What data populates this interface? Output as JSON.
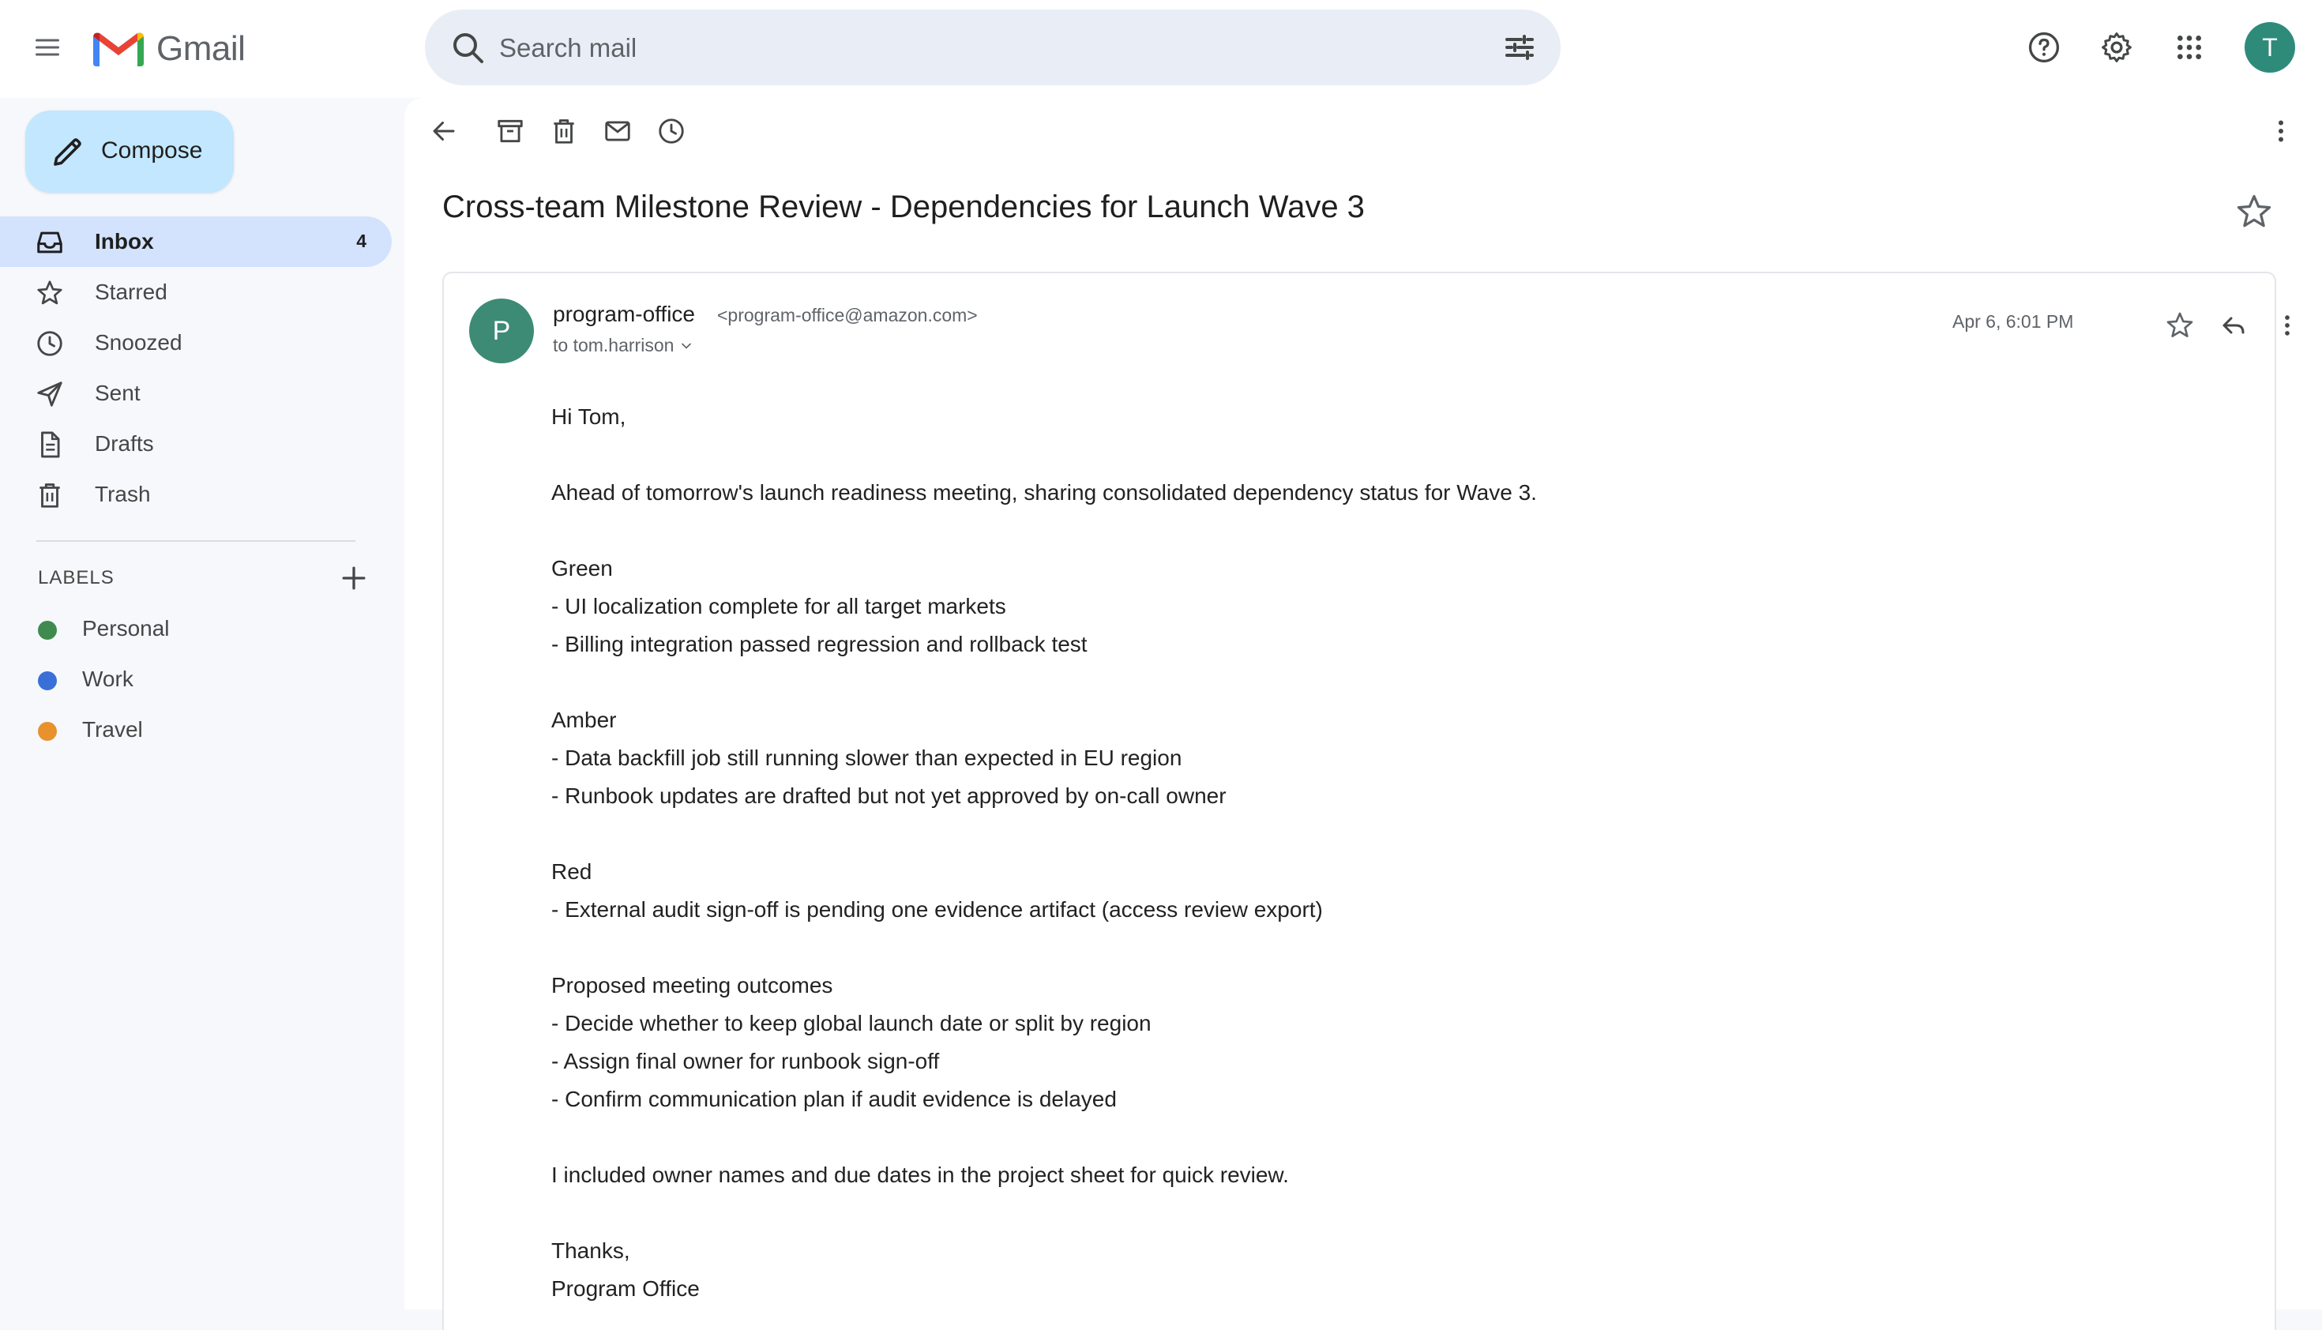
{
  "app": {
    "name": "Gmail"
  },
  "search": {
    "placeholder": "Search mail"
  },
  "header": {
    "user_initial": "T",
    "icons": [
      "help-icon",
      "settings-icon",
      "apps-icon"
    ]
  },
  "sidebar": {
    "compose_label": "Compose",
    "items": [
      {
        "label": "Inbox",
        "count": "4",
        "icon": "inbox-icon",
        "active": true
      },
      {
        "label": "Starred",
        "icon": "star-icon"
      },
      {
        "label": "Snoozed",
        "icon": "clock-icon"
      },
      {
        "label": "Sent",
        "icon": "send-icon"
      },
      {
        "label": "Drafts",
        "icon": "draft-icon"
      },
      {
        "label": "Trash",
        "icon": "trash-icon"
      }
    ],
    "labels_heading": "LABELS",
    "labels": [
      {
        "label": "Personal",
        "color": "#3f8a4f"
      },
      {
        "label": "Work",
        "color": "#3b6fd8"
      },
      {
        "label": "Travel",
        "color": "#e8912d"
      }
    ]
  },
  "toolbar": {
    "icons": [
      "back-arrow-icon",
      "archive-icon",
      "delete-icon",
      "mark-unread-icon",
      "snooze-icon",
      "more-vert-icon"
    ]
  },
  "email": {
    "subject": "Cross-team Milestone Review - Dependencies for Launch Wave 3",
    "sender_initial": "P",
    "sender_name": "program-office",
    "sender_email": "<program-office@amazon.com>",
    "to": "to tom.harrison",
    "date": "Apr 6, 6:01 PM",
    "body_lines": [
      "Hi Tom,",
      "",
      "Ahead of tomorrow's launch readiness meeting, sharing consolidated dependency status for Wave 3.",
      "",
      "Green",
      "- UI localization complete for all target markets",
      "- Billing integration passed regression and rollback test",
      "",
      "Amber",
      "- Data backfill job still running slower than expected in EU region",
      "- Runbook updates are drafted but not yet approved by on-call owner",
      "",
      "Red",
      "- External audit sign-off is pending one evidence artifact (access review export)",
      "",
      "Proposed meeting outcomes",
      "- Decide whether to keep global launch date or split by region",
      "- Assign final owner for runbook sign-off",
      "- Confirm communication plan if audit evidence is delayed",
      "",
      "I included owner names and due dates in the project sheet for quick review.",
      "",
      "Thanks,",
      "Program Office"
    ]
  },
  "colors": {
    "background": "#f6f8fc",
    "search_bg": "#e9eef6",
    "compose_bg": "#c2e7ff",
    "active_nav_bg": "#d3e3fd",
    "user_avatar": "#2e8b7a",
    "sender_avatar": "#3d8b74"
  }
}
